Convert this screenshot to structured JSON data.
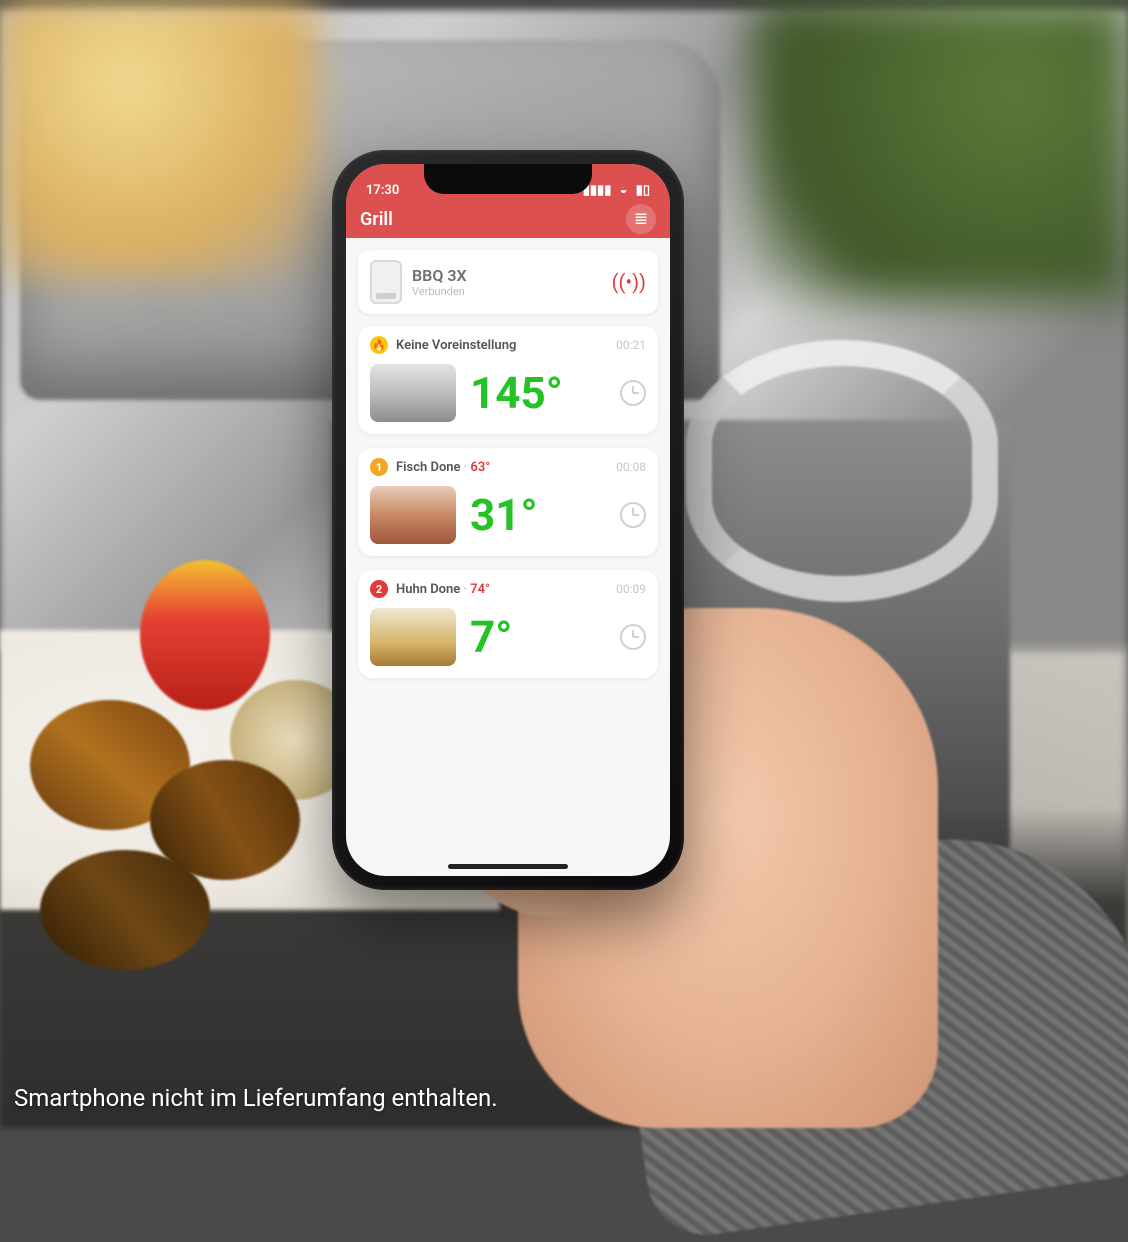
{
  "statusbar": {
    "time": "17:30"
  },
  "header": {
    "title": "Grill"
  },
  "device": {
    "name": "BBQ 3X",
    "status": "Verbunden"
  },
  "probes": [
    {
      "chip": "🔥",
      "label": "Keine Voreinstellung",
      "target": "",
      "timer": "00:21",
      "temp": "145°",
      "thumb": "thumb-grill"
    },
    {
      "chip": "1",
      "label": "Fisch Done",
      "target": "63°",
      "timer": "00:08",
      "temp": "31°",
      "thumb": "thumb-fish"
    },
    {
      "chip": "2",
      "label": "Huhn Done",
      "target": "74°",
      "timer": "00:09",
      "temp": "7°",
      "thumb": "thumb-chick"
    }
  ],
  "disclaimer": "Smartphone nicht im Lieferumfang enthalten."
}
